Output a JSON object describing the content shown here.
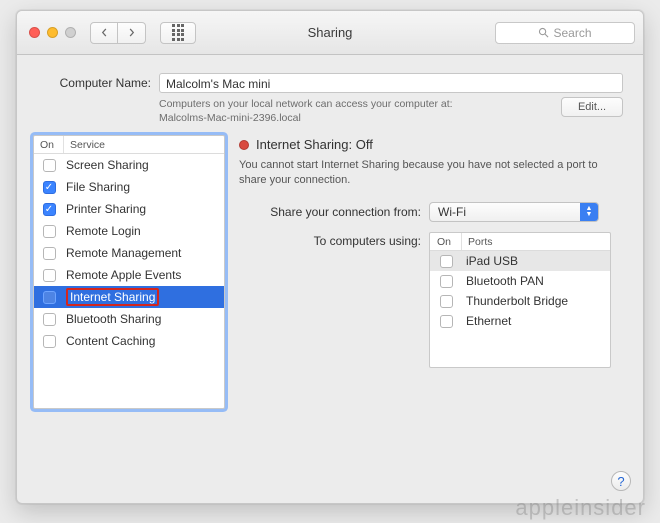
{
  "window": {
    "title": "Sharing",
    "search_placeholder": "Search"
  },
  "computer_name": {
    "label": "Computer Name:",
    "value": "Malcolm's Mac mini",
    "hint_line1": "Computers on your local network can access your computer at:",
    "hint_line2": "Malcolms-Mac-mini-2396.local",
    "edit_label": "Edit..."
  },
  "services": {
    "header_on": "On",
    "header_service": "Service",
    "items": [
      {
        "name": "Screen Sharing",
        "checked": false,
        "selected": false
      },
      {
        "name": "File Sharing",
        "checked": true,
        "selected": false
      },
      {
        "name": "Printer Sharing",
        "checked": true,
        "selected": false
      },
      {
        "name": "Remote Login",
        "checked": false,
        "selected": false
      },
      {
        "name": "Remote Management",
        "checked": false,
        "selected": false
      },
      {
        "name": "Remote Apple Events",
        "checked": false,
        "selected": false
      },
      {
        "name": "Internet Sharing",
        "checked": false,
        "selected": true
      },
      {
        "name": "Bluetooth Sharing",
        "checked": false,
        "selected": false
      },
      {
        "name": "Content Caching",
        "checked": false,
        "selected": false
      }
    ]
  },
  "detail": {
    "status_text": "Internet Sharing: Off",
    "status_color": "#d94a3f",
    "description": "You cannot start Internet Sharing because you have not selected a port to share your connection.",
    "share_from_label": "Share your connection from:",
    "share_from_value": "Wi-Fi",
    "to_label": "To computers using:",
    "ports_header_on": "On",
    "ports_header_ports": "Ports",
    "ports": [
      {
        "name": "iPad USB",
        "checked": false,
        "selected": true
      },
      {
        "name": "Bluetooth PAN",
        "checked": false,
        "selected": false
      },
      {
        "name": "Thunderbolt Bridge",
        "checked": false,
        "selected": false
      },
      {
        "name": "Ethernet",
        "checked": false,
        "selected": false
      }
    ]
  },
  "watermark": "appleinsider"
}
